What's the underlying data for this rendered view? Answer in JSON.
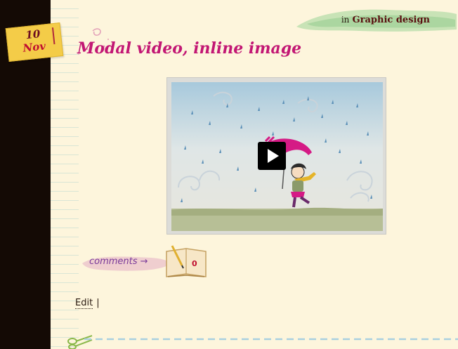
{
  "post": {
    "date_day": "10",
    "date_month": "Nov",
    "title": "Modal video, inline image",
    "category_prefix": "in",
    "category_name": "Graphic design"
  },
  "video": {
    "play_label": "Play video"
  },
  "comments": {
    "label": "comments →",
    "count": "0"
  },
  "edit": {
    "label": "Edit",
    "separator": "|"
  },
  "colors": {
    "title": "#c21774",
    "date_note": "#f4cc48",
    "dark_strip": "#140a05",
    "paper": "#fdf5dc"
  }
}
